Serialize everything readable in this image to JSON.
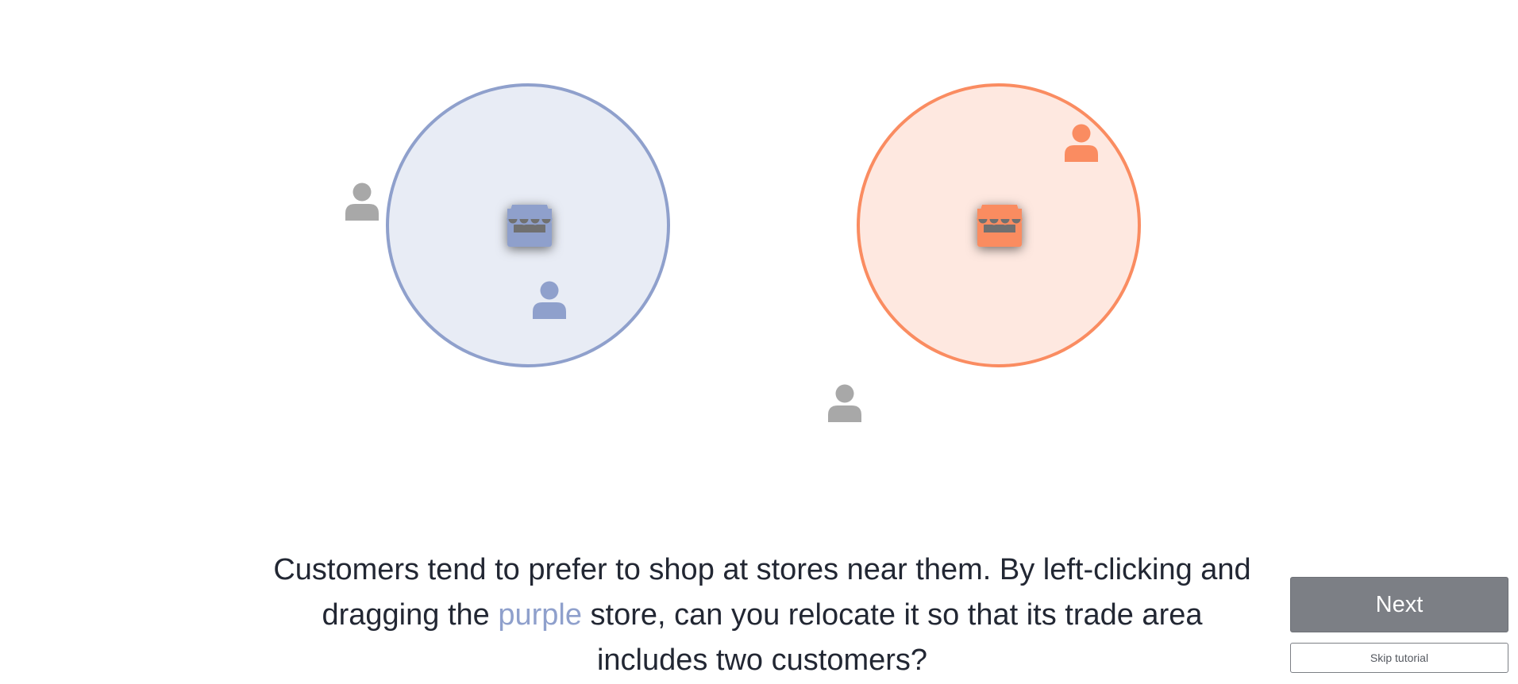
{
  "instruction": {
    "part1": "Customers tend to prefer to shop at stores near them. By left-clicking and dragging the ",
    "highlight": "purple",
    "part2": " store, can you relocate it so that its trade area includes two customers?"
  },
  "buttons": {
    "next_label": "Next",
    "skip_label": "Skip tutorial"
  },
  "colors": {
    "purple_store": "#8fa0cc",
    "purple_area_fill": "#e8ecf5",
    "orange_store": "#fa8c61",
    "orange_area_fill": "#fee8e0",
    "neutral_customer": "#a8a8a8",
    "text": "#222733",
    "button_bg": "#7c7f85"
  },
  "scene": {
    "stores": [
      {
        "id": "purple",
        "color_key": "purple_store",
        "fill_key": "purple_area_fill",
        "icon": "storefront-icon",
        "draggable": true
      },
      {
        "id": "orange",
        "color_key": "orange_store",
        "fill_key": "orange_area_fill",
        "icon": "storefront-icon",
        "draggable": false
      }
    ],
    "customers": [
      {
        "id": "customer-1",
        "color_key": "neutral_customer",
        "icon": "person-icon",
        "served_by": null
      },
      {
        "id": "customer-2",
        "color_key": "purple_store",
        "icon": "person-icon",
        "served_by": "purple"
      },
      {
        "id": "customer-3",
        "color_key": "orange_store",
        "icon": "person-icon",
        "served_by": "orange"
      },
      {
        "id": "customer-4",
        "color_key": "neutral_customer",
        "icon": "person-icon",
        "served_by": null
      }
    ]
  }
}
